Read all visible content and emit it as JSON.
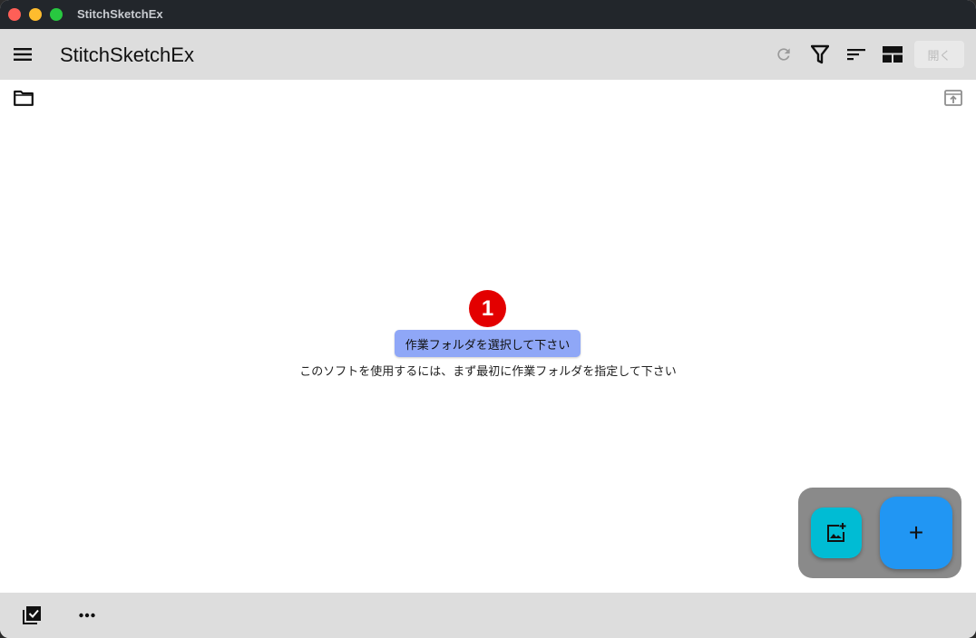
{
  "window": {
    "title": "StitchSketchEx"
  },
  "appbar": {
    "title": "StitchSketchEx",
    "open_label": "開く",
    "icons": [
      "menu-icon",
      "refresh-icon",
      "filter-icon",
      "sort-icon",
      "layout-icon"
    ]
  },
  "content": {
    "badge": "1",
    "select_folder_label": "作業フォルダを選択して下さい",
    "hint": "このソフトを使用するには、まず最初に作業フォルダを指定して下さい",
    "icons": [
      "folder-icon",
      "open-folder-icon"
    ]
  },
  "fab": {
    "add_label": "+",
    "icons": [
      "add-image-icon"
    ]
  },
  "bottombar": {
    "icons": [
      "select-all-icon",
      "more-icon"
    ]
  }
}
